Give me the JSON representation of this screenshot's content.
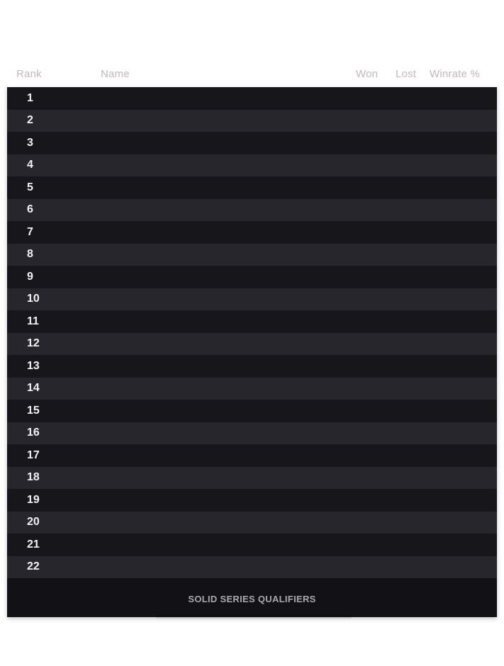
{
  "leaderboard": {
    "columns": {
      "rank": "Rank",
      "name": "Name",
      "won": "Won",
      "lost": "Lost",
      "winrate": "Winrate %"
    },
    "ranks": [
      "1",
      "2",
      "3",
      "4",
      "5",
      "6",
      "7",
      "8",
      "9",
      "10",
      "11",
      "12",
      "13",
      "14",
      "15",
      "16",
      "17",
      "18",
      "19",
      "20",
      "21",
      "22"
    ],
    "footer_title": "SOLID SERIES QUALIFIERS"
  }
}
